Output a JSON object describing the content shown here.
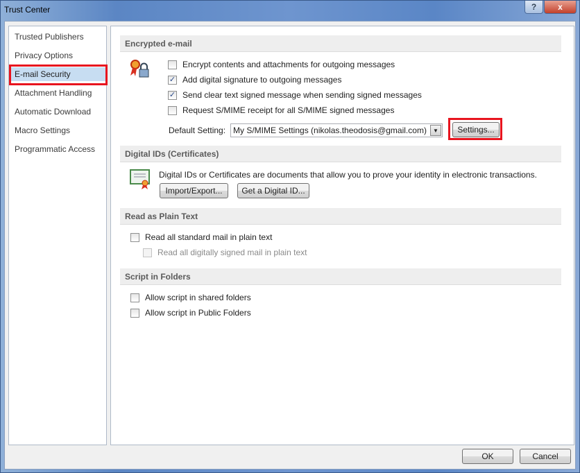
{
  "window": {
    "title": "Trust Center",
    "help": "?",
    "close": "x"
  },
  "sidebar": {
    "items": [
      {
        "label": "Trusted Publishers"
      },
      {
        "label": "Privacy Options"
      },
      {
        "label": "E-mail Security",
        "selected": true
      },
      {
        "label": "Attachment Handling"
      },
      {
        "label": "Automatic Download"
      },
      {
        "label": "Macro Settings"
      },
      {
        "label": "Programmatic Access"
      }
    ]
  },
  "encrypted": {
    "header": "Encrypted e-mail",
    "options": [
      {
        "label": "Encrypt contents and attachments for outgoing messages",
        "checked": false
      },
      {
        "label": "Add digital signature to outgoing messages",
        "checked": true
      },
      {
        "label": "Send clear text signed message when sending signed messages",
        "checked": true
      },
      {
        "label": "Request S/MIME receipt for all S/MIME signed messages",
        "checked": false
      }
    ],
    "default_label": "Default Setting:",
    "default_value": "My S/MIME Settings (nikolas.theodosis@gmail.com)",
    "settings_button": "Settings..."
  },
  "digital_ids": {
    "header": "Digital IDs (Certificates)",
    "description": "Digital IDs or Certificates are documents that allow you to prove your identity in electronic transactions.",
    "import_button": "Import/Export...",
    "get_button": "Get a Digital ID..."
  },
  "plain_text": {
    "header": "Read as Plain Text",
    "options": [
      {
        "label": "Read all standard mail in plain text",
        "checked": false
      },
      {
        "label": "Read all digitally signed mail in plain text",
        "checked": false,
        "disabled": true
      }
    ]
  },
  "script": {
    "header": "Script in Folders",
    "options": [
      {
        "label": "Allow script in shared folders",
        "checked": false
      },
      {
        "label": "Allow script in Public Folders",
        "checked": false
      }
    ]
  },
  "footer": {
    "ok": "OK",
    "cancel": "Cancel"
  },
  "colors": {
    "highlight": "#e8141e",
    "selected": "#c7ddf2"
  }
}
